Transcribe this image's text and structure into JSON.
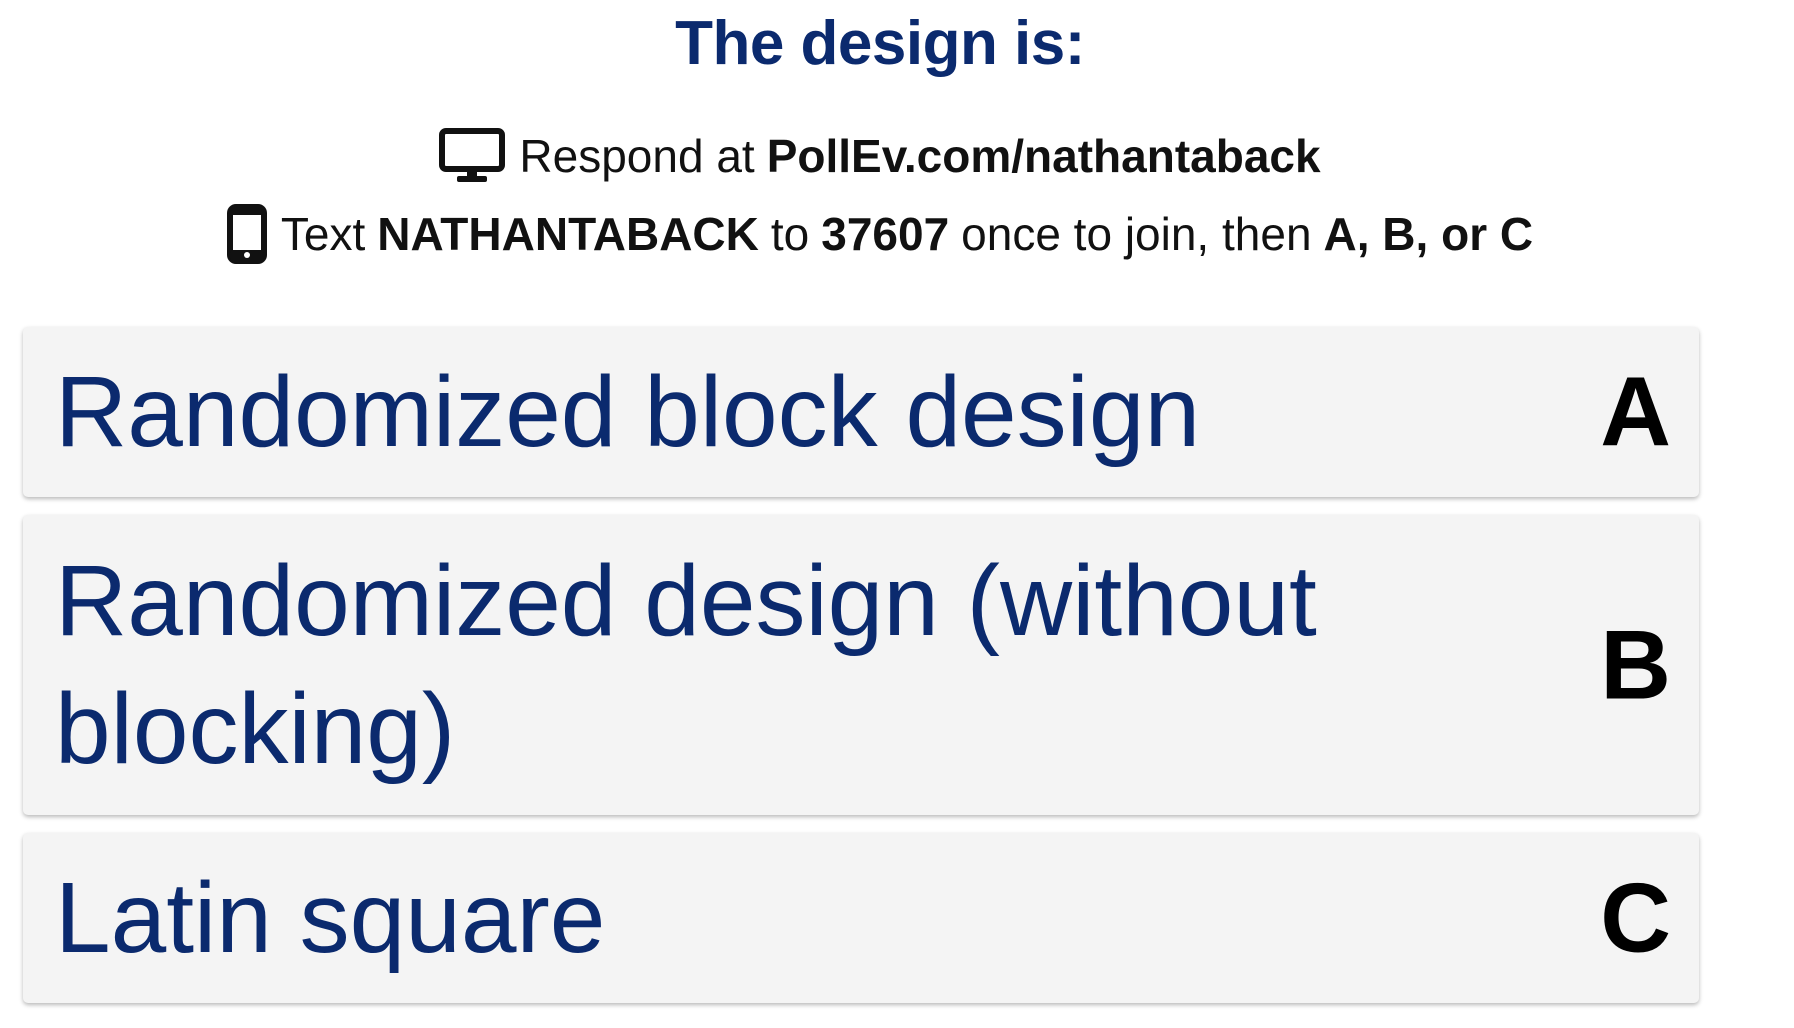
{
  "question": {
    "title": "The design is:"
  },
  "instructions": {
    "web": {
      "icon": "monitor-icon",
      "prefix": "Respond at",
      "url": "PollEv.com/nathantaback"
    },
    "text": {
      "icon": "phone-icon",
      "prefix": "Text",
      "keyword": "NATHANTABACK",
      "to": "to",
      "number": "37607",
      "middle": "once to join, then",
      "choices": "A, B, or C"
    }
  },
  "options": [
    {
      "label": "Randomized block design",
      "letter": "A"
    },
    {
      "label": "Randomized design (without blocking)",
      "letter": "B"
    },
    {
      "label": "Latin square",
      "letter": "C"
    }
  ],
  "colors": {
    "title": "#0b2a6e",
    "option_text": "#0b2a6e",
    "option_bg": "#f4f4f4",
    "letter": "#000000"
  }
}
